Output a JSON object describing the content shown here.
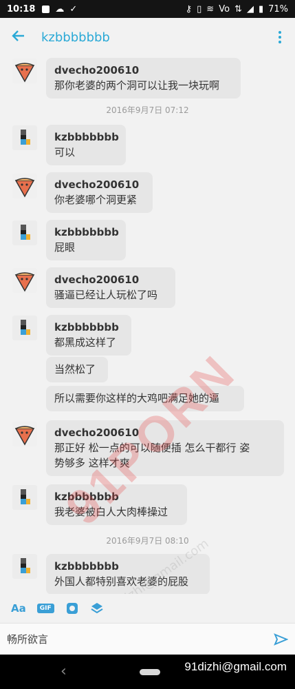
{
  "status_bar": {
    "time": "10:18",
    "network": "Vo",
    "battery": "71%"
  },
  "header": {
    "title": "kzbbbbbbb"
  },
  "messages": [
    {
      "sender": "dvecho200610",
      "lines": [
        "那你老婆的两个洞可以让我一块玩啊"
      ]
    },
    {
      "timestamp": "2016年9月7日 07:12"
    },
    {
      "sender": "kzbbbbbbb",
      "lines": [
        "可以"
      ]
    },
    {
      "sender": "dvecho200610",
      "lines": [
        "你老婆哪个洞更紧"
      ]
    },
    {
      "sender": "kzbbbbbbb",
      "lines": [
        "屁眼"
      ]
    },
    {
      "sender": "dvecho200610",
      "lines": [
        "骚逼已经让人玩松了吗"
      ]
    },
    {
      "sender": "kzbbbbbbb",
      "lines": [
        "都黑成这样了"
      ]
    },
    {
      "lines": [
        "当然松了"
      ]
    },
    {
      "lines": [
        "所以需要你这样的大鸡吧满足她的逼"
      ]
    },
    {
      "sender": "dvecho200610",
      "lines": [
        "那正好 松一点的可以随便插 怎么干都行 姿",
        "势够多 这样才爽"
      ]
    },
    {
      "sender": "kzbbbbbbb",
      "lines": [
        "我老婆被白人大肉棒操过"
      ]
    },
    {
      "timestamp": "2016年9月7日 08:10"
    },
    {
      "sender": "kzbbbbbbb",
      "lines": [
        "外国人都特别喜欢老婆的屁股"
      ]
    }
  ],
  "watermark": {
    "brand": "91PORN",
    "email": "91dizhi@gmail.com"
  },
  "toolbar": {
    "font_label": "Aa",
    "gif_label": "GIF"
  },
  "input": {
    "placeholder": "畅所欲言"
  },
  "nav_bar": {
    "email": "91dizhi@gmail.com"
  },
  "colors": {
    "accent": "#2aa9d6",
    "bubble": "#e6e6e6",
    "background": "#f2f2f2"
  }
}
